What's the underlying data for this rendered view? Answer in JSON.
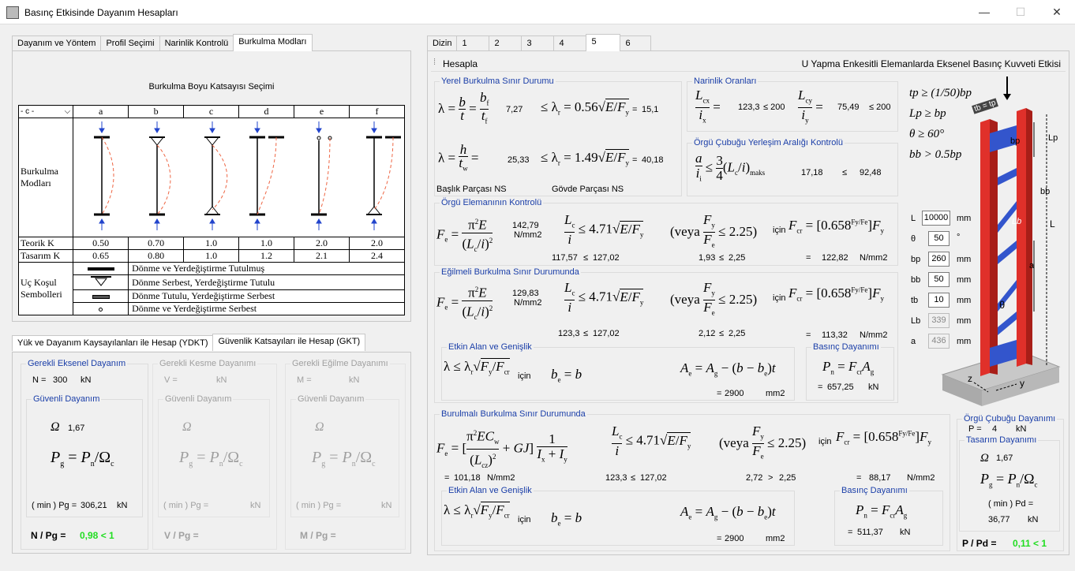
{
  "window": {
    "title": "Basınç Etkisinde Dayanım Hesapları",
    "min": "—",
    "max": "☐",
    "close": "✕"
  },
  "left_tabs": [
    "Dayanım ve Yöntem",
    "Profil Seçimi",
    "Narinlik Kontrolü",
    "Burkulma Modları"
  ],
  "buckling": {
    "title": "Burkulma Boyu Katsayısı Seçimi",
    "select": "- c -",
    "cols": [
      "a",
      "b",
      "c",
      "d",
      "e",
      "f"
    ],
    "row_modes": "Burkulma Modları",
    "row_teorik": "Teorik K",
    "teorik": [
      "0.50",
      "0.70",
      "1.0",
      "1.0",
      "2.0",
      "2.0"
    ],
    "row_tasarim": "Tasarım K",
    "tasarim": [
      "0.65",
      "0.80",
      "1.0",
      "1.2",
      "2.1",
      "2.4"
    ],
    "row_symbols": "Uç Koşul Sembolleri",
    "symbols": [
      "Dönme ve Yerdeğiştirme Tutulmuş",
      "Dönme Serbest, Yerdeğiştirme Tutulu",
      "Dönme Tutulu, Yerdeğiştirme Serbest",
      "Dönme ve Yerdeğiştirme Serbest"
    ]
  },
  "lower_tabs": [
    "Yük ve Dayanım Kaysayılanları ile Hesap (YDKT)",
    "Güvenlik Katsayıları ile Hesap (GKT)"
  ],
  "axial": {
    "title": "Gerekli Eksenel Dayanım",
    "n_label": "N =",
    "n_val": "300",
    "unit": "kN",
    "safe_title": "Güvenli Dayanım",
    "omega": "Ω",
    "omega_val": "1,67",
    "pg_label": "( min ) Pg =",
    "pg_val": "306,21",
    "pg_unit": "kN",
    "ratio_label": "N / Pg =",
    "ratio_val": "0,98 < 1"
  },
  "shear": {
    "title": "Gerekli Kesme Dayanımı",
    "v_label": "V =",
    "unit": "kN",
    "safe_title": "Güvenli Dayanım",
    "omega": "Ω",
    "pg_label": "( min ) Pg =",
    "ratio_label": "V / Pg ="
  },
  "bending": {
    "title": "Gerekli Eğilme Dayanımı",
    "m_label": "M =",
    "unit": "kN",
    "safe_title": "Güvenli Dayanım",
    "omega": "Ω",
    "pg_label": "( min ) Pg =",
    "ratio_label": "M / Pg ="
  },
  "right_tabs": [
    "Dizin",
    "1",
    "2",
    "3",
    "4",
    "5",
    "6"
  ],
  "header": {
    "hesapla": "Hesapla",
    "title": "U Yapma Enkesitli Elemanlarda Eksenel Basınç Kuvveti Etkisi"
  },
  "local": {
    "title": "Yerel Burkulma Sınır Durumu",
    "v1": "7,27",
    "v2": "15,1",
    "v3": "25,33",
    "v4": "40,18",
    "flange": "Başlık Parçası  NS",
    "web": "Gövde Parçası  NS"
  },
  "slender": {
    "title": "Narinlik Oranları",
    "v1": "123,3",
    "l1": "≤ 200",
    "v2": "75,49",
    "l2": "≤ 200"
  },
  "spacing": {
    "title": "Örgü Çubuğu Yerleşim Aralığı Kontrolü",
    "v1": "17,18",
    "l1": "≤",
    "v2": "92,48"
  },
  "lacing": {
    "title": "Örgü Elemanının Kontrolü",
    "fe": "142,79",
    "fe_unit": "N/mm2",
    "s1": "117,57",
    "s1op": "≤",
    "s1b": "127,02",
    "s2": "1,93",
    "s2op": "≤",
    "s2b": "2,25",
    "fcr_eq": "=",
    "fcr": "122,82",
    "fcr_unit": "N/mm2"
  },
  "flexural": {
    "title": "Eğilmeli Burkulma Sınır Durumunda",
    "fe": "129,83",
    "fe_unit": "N/mm2",
    "s1": "123,3",
    "s1op": "≤",
    "s1b": "127,02",
    "s2": "2,12",
    "s2op": "≤",
    "s2b": "2,25",
    "fcr_eq": "=",
    "fcr": "113,32",
    "fcr_unit": "N/mm2"
  },
  "eff1": {
    "title": "Etkin Alan ve Genişlik",
    "icin": "için",
    "ae_eq": "=",
    "ae": "2900",
    "ae_unit": "mm2"
  },
  "basinc1": {
    "title": "Basınç Dayanımı",
    "eq": "=",
    "val": "657,25",
    "unit": "kN"
  },
  "torsional": {
    "title": "Burulmalı Burkulma Sınır Durumunda",
    "fe_eq": "=",
    "fe": "101,18",
    "fe_unit": "N/mm2",
    "s1": "123,3",
    "s1op": "≤",
    "s1b": "127,02",
    "s2": "2,72",
    "s2op": ">",
    "s2b": "2,25",
    "fcr_eq": "=",
    "fcr": "88,17",
    "fcr_unit": "N/mm2"
  },
  "eff2": {
    "title": "Etkin Alan ve Genişlik",
    "icin": "için",
    "ae_eq": "=",
    "ae": "2900",
    "ae_unit": "mm2"
  },
  "basinc2": {
    "title": "Basınç Dayanımı",
    "eq": "=",
    "val": "511,37",
    "unit": "kN"
  },
  "lacing_strength": {
    "title": "Örgü Çubuğu Dayanımı",
    "p_label": "P =",
    "p_val": "4",
    "p_unit": "kN",
    "design_title": "Tasarım Dayanımı",
    "omega_val": "1,67",
    "pd_label": "( min ) Pd =",
    "pd_val": "36,77",
    "pd_unit": "kN",
    "ratio_label": "P / Pd =",
    "ratio_val": "0,11 < 1"
  },
  "rules": {
    "r1": "tp ≥ (1/50)bp",
    "r2": "Lp ≥ bp",
    "r3": "θ ≥ 60°",
    "r4": "bb > 0.5bp"
  },
  "dims": [
    {
      "label": "L",
      "val": "10000",
      "unit": "mm",
      "dis": false
    },
    {
      "label": "θ",
      "val": "50",
      "unit": "°",
      "dis": false
    },
    {
      "label": "bp",
      "val": "260",
      "unit": "mm",
      "dis": false
    },
    {
      "label": "bb",
      "val": "50",
      "unit": "mm",
      "dis": false
    },
    {
      "label": "tb",
      "val": "10",
      "unit": "mm",
      "dis": false
    },
    {
      "label": "Lb",
      "val": "339",
      "unit": "mm",
      "dis": true
    },
    {
      "label": "a",
      "val": "436",
      "unit": "mm",
      "dis": true
    }
  ],
  "fig": {
    "tb_tp": "tb = tp",
    "bp": "bp",
    "lp": "Lp",
    "bb": "bb",
    "lb": "Lb",
    "l": "L",
    "a": "a",
    "theta": "θ",
    "z": "z",
    "y": "y"
  },
  "colors": {
    "accent": "#1a3ea8",
    "ok": "#22dd22",
    "column": "#e0302a",
    "lacing": "#3355cc"
  }
}
